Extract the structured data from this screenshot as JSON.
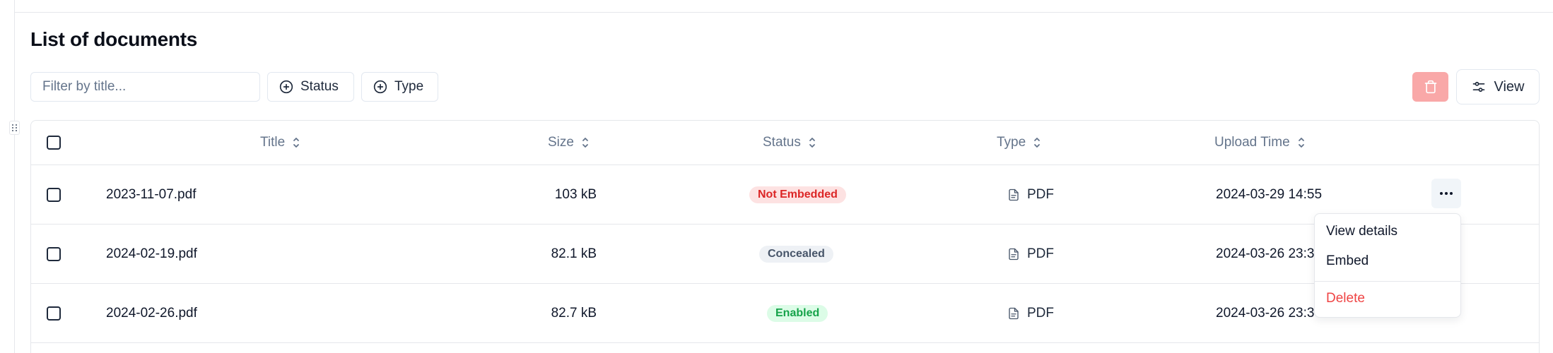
{
  "page": {
    "title": "List of documents"
  },
  "toolbar": {
    "filter_placeholder": "Filter by title...",
    "status_chip": "Status",
    "type_chip": "Type",
    "view_button": "View"
  },
  "table": {
    "columns": [
      "Title",
      "Size",
      "Status",
      "Type",
      "Upload Time"
    ],
    "rows": [
      {
        "title": "2023-11-07.pdf",
        "size": "103 kB",
        "status": "Not Embedded",
        "type": "PDF",
        "upload_time": "2024-03-29 14:55"
      },
      {
        "title": "2024-02-19.pdf",
        "size": "82.1 kB",
        "status": "Concealed",
        "type": "PDF",
        "upload_time": "2024-03-26 23:3"
      },
      {
        "title": "2024-02-26.pdf",
        "size": "82.7 kB",
        "status": "Enabled",
        "type": "PDF",
        "upload_time": "2024-03-26 23:3"
      }
    ]
  },
  "row_menu": {
    "items": [
      "View details",
      "Embed",
      "Delete"
    ]
  },
  "colors": {
    "destructive": "#ef4444",
    "badge_not_embedded": "#dc2626",
    "badge_enabled": "#16a34a",
    "badge_concealed": "#475569"
  }
}
